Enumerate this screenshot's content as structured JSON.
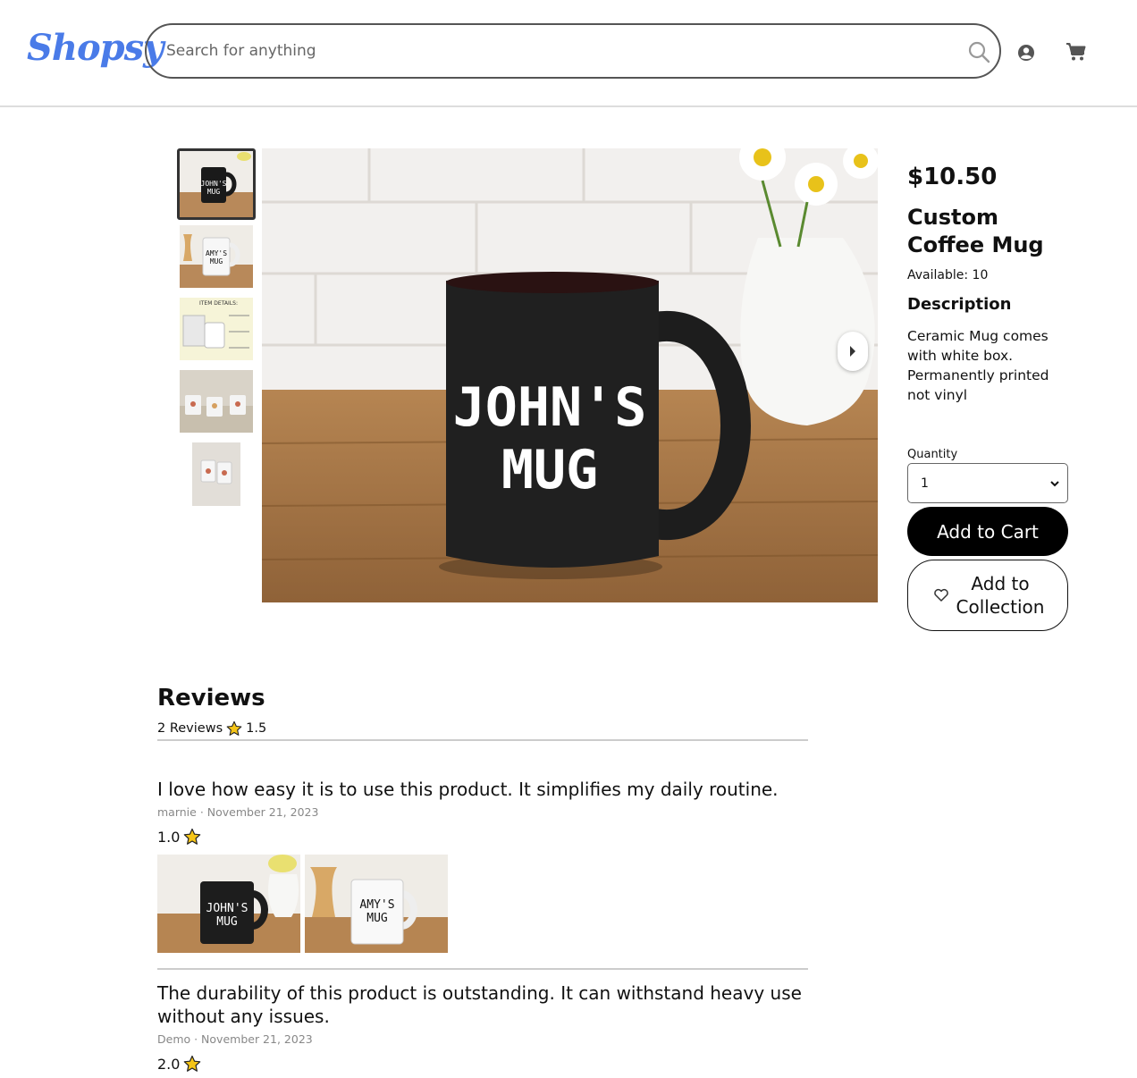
{
  "header": {
    "logo": "Shopsy",
    "search_placeholder": "Search for anything"
  },
  "product": {
    "price": "$10.50",
    "title": "Custom Coffee Mug",
    "available": "Available: 10",
    "description_heading": "Description",
    "description": "Ceramic Mug comes with white box. Permanently printed not vinyl",
    "quantity_label": "Quantity",
    "quantity_value": "1",
    "add_to_cart": "Add to Cart",
    "add_to_collection": "Add to Collection",
    "main_mug_text": [
      "JOHN'S",
      "MUG"
    ],
    "thumb_mug2_text": [
      "AMY'S",
      "MUG"
    ],
    "thumb_details_text": "ITEM DETAILS:"
  },
  "reviews": {
    "heading": "Reviews",
    "count_label": "2 Reviews",
    "average": "1.5",
    "items": [
      {
        "text": "I love how easy it is to use this product. It simplifies my daily routine.",
        "meta": "marnie · November 21, 2023",
        "rating": "1.0"
      },
      {
        "text": "The durability of this product is outstanding. It can withstand heavy use without any issues.",
        "meta": "Demo · November 21, 2023",
        "rating": "2.0"
      }
    ]
  },
  "colors": {
    "brand": "#4a7be8",
    "star": "#f5c518",
    "button_dark": "#000000"
  }
}
